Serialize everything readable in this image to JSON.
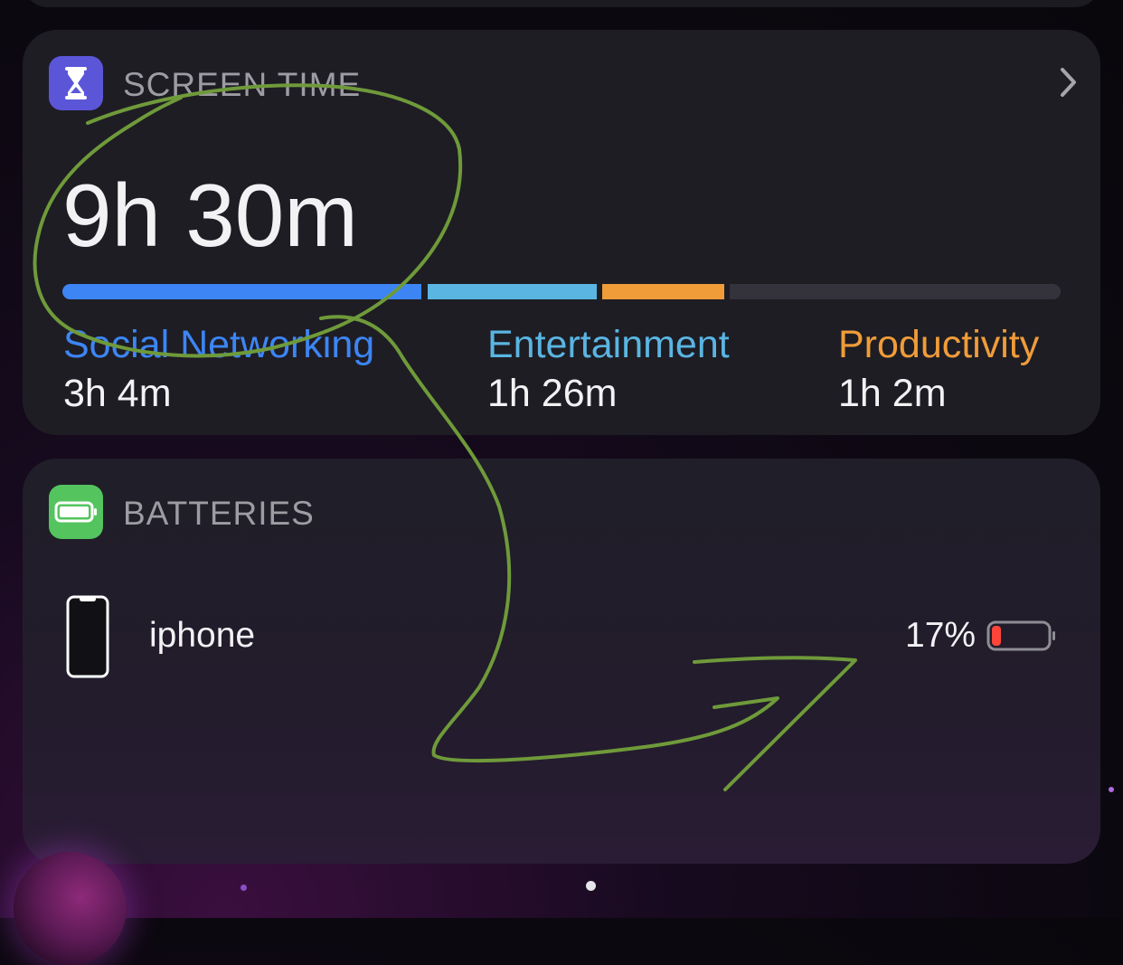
{
  "screen_time": {
    "title": "SCREEN TIME",
    "total": "9h 30m",
    "categories": [
      {
        "name": "Social Networking",
        "time": "3h 4m",
        "color": "#3d85f4"
      },
      {
        "name": "Entertainment",
        "time": "1h 26m",
        "color": "#5ab5e2"
      },
      {
        "name": "Productivity",
        "time": "1h 2m",
        "color": "#f09c39"
      }
    ]
  },
  "batteries": {
    "title": "BATTERIES",
    "devices": [
      {
        "name": "iphone",
        "percent": "17%",
        "level": 0.17,
        "status_color": "#ff453a"
      }
    ]
  },
  "annotation": {
    "color": "#6f9a3a",
    "description_icon": "hand-drawn-circle-and-arrow"
  },
  "icons": {
    "screen_time": "hourglass-icon",
    "batteries": "battery-icon",
    "chevron": "chevron-right-icon",
    "device": "iphone-icon"
  }
}
